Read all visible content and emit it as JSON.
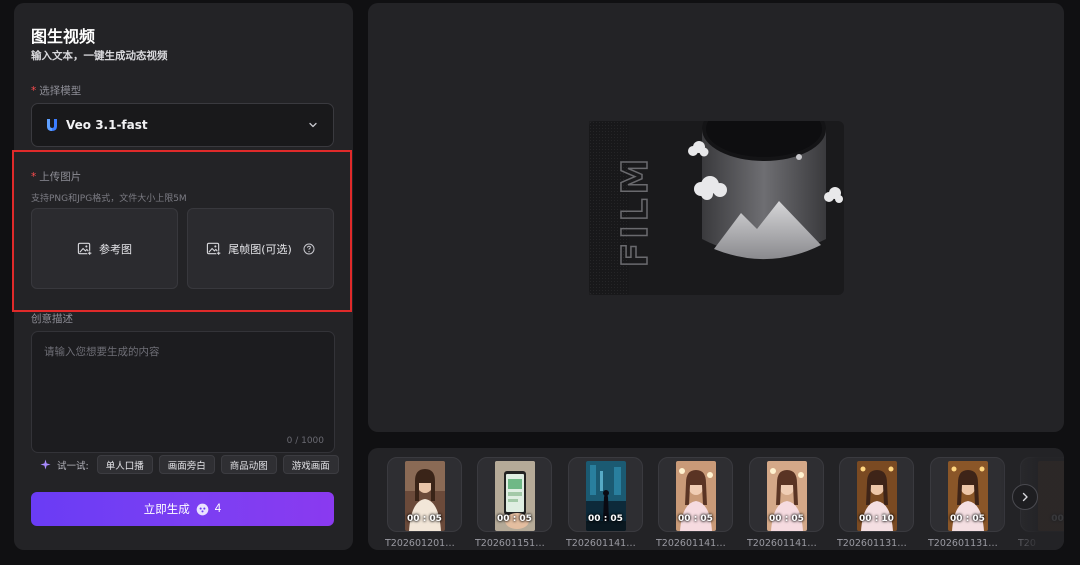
{
  "panel": {
    "title": "图生视频",
    "subtitle": "输入文本，一键生成动态视频"
  },
  "model": {
    "label": "选择模型",
    "required_mark": "*",
    "selected": "Veo 3.1-fast"
  },
  "upload": {
    "label": "上传图片",
    "required_mark": "*",
    "hint": "支持PNG和JPG格式，文件大小上限5M",
    "reference_label": "参考图",
    "end_frame_label": "尾帧图(可选)"
  },
  "prompt": {
    "label": "创意描述",
    "placeholder": "请输入您想要生成的内容",
    "char_count": "0 / 1000"
  },
  "suggestions": {
    "label": "试一试:",
    "chips": [
      "单人口播",
      "画面旁白",
      "商品动图",
      "游戏画面"
    ]
  },
  "generate": {
    "label": "立即生成",
    "cost": "4"
  },
  "colors": {
    "accent": "#7b3ff2",
    "highlight": "#e02a2a"
  },
  "history": [
    {
      "duration": "00 : 05",
      "name": "T202601201…"
    },
    {
      "duration": "00 : 05",
      "name": "T202601151…"
    },
    {
      "duration": "00 : 05",
      "name": "T202601141…"
    },
    {
      "duration": "00 : 05",
      "name": "T202601141…"
    },
    {
      "duration": "00 : 05",
      "name": "T202601141…"
    },
    {
      "duration": "00 : 10",
      "name": "T202601131…"
    },
    {
      "duration": "00 : 05",
      "name": "T202601131…"
    },
    {
      "duration": "00",
      "name": "T20"
    }
  ]
}
